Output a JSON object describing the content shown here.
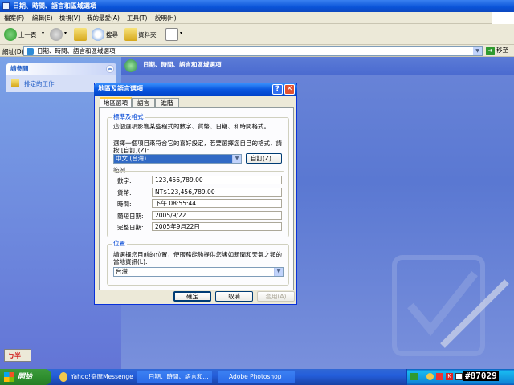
{
  "window": {
    "title": "日期、時間、語言和區域選項"
  },
  "menubar": {
    "items": [
      "檔案(F)",
      "編輯(E)",
      "檢視(V)",
      "我的最愛(A)",
      "工具(T)",
      "說明(H)"
    ]
  },
  "toolbar": {
    "back_label": "上一頁",
    "search_label": "搜尋",
    "folders_label": "資料夾"
  },
  "addressbar": {
    "label": "網址(D)",
    "value": "日期、時間、語言和區域選項",
    "go_label": "移至"
  },
  "leftpane": {
    "see_also_title": "請參閱",
    "scheduled_tasks": "排定的工作"
  },
  "main": {
    "header_title": "日期、時間、語言和區域選項"
  },
  "dialog": {
    "title": "地區及語言選項",
    "tabs": [
      "地區選項",
      "語言",
      "進階"
    ],
    "standards": {
      "group_title": "標準及格式",
      "description": "這個選項影響某些程式的數字、貨幣、日期、和時間格式。",
      "instruction_line1": "選擇一個項目來符合它的喜好設定，若要選擇您自己的格式，請",
      "instruction_line2": "按 [自訂](Z):",
      "selected_format": "中文 (台灣)",
      "customize_button": "自訂(Z)...",
      "samples_title": "範例",
      "samples": [
        {
          "label": "數字:",
          "value": "123,456,789.00"
        },
        {
          "label": "貨幣:",
          "value": "NT$123,456,789.00"
        },
        {
          "label": "時間:",
          "value": "下午 08:55:44"
        },
        {
          "label": "簡短日期:",
          "value": "2005/9/22"
        },
        {
          "label": "完整日期:",
          "value": "2005年9月22日"
        }
      ]
    },
    "location": {
      "group_title": "位置",
      "instruction_line1": "請選擇您目前的位置，使服務能夠提供您諸如新聞和天氣之類的",
      "instruction_line2": "當地資訊(L):",
      "selected_location": "台灣"
    },
    "buttons": {
      "ok": "確定",
      "cancel": "取消",
      "apply": "套用(A)"
    }
  },
  "ime": {
    "label": "ㄅ半"
  },
  "taskbar": {
    "start_label": "開始",
    "tasks": [
      "Yahoo!奇摩Messenger",
      "日期、時間、語言和...",
      "Adobe Photoshop"
    ],
    "tray_text": "#87029"
  }
}
